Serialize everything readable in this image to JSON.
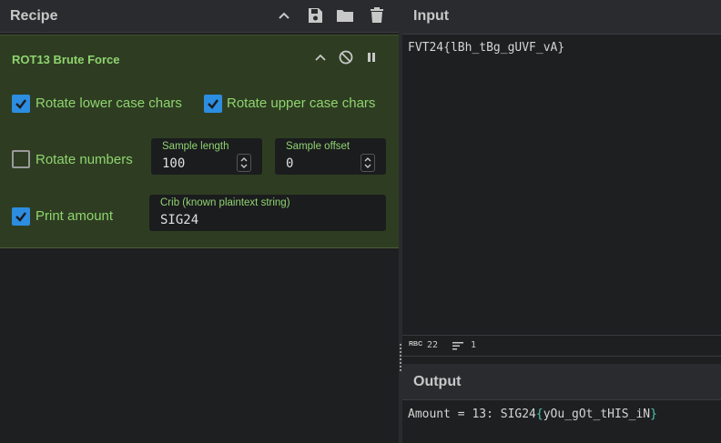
{
  "recipe": {
    "title": "Recipe",
    "header_icons": [
      "chevron-up-icon",
      "save-icon",
      "folder-icon",
      "trash-icon"
    ]
  },
  "operation": {
    "title": "ROT13 Brute Force",
    "icons": [
      "chevron-up-icon",
      "disable-icon",
      "pause-icon"
    ],
    "options": {
      "rotate_lower": {
        "label": "Rotate lower case chars",
        "checked": true
      },
      "rotate_upper": {
        "label": "Rotate upper case chars",
        "checked": true
      },
      "rotate_numbers": {
        "label": "Rotate numbers",
        "checked": false
      },
      "print_amount": {
        "label": "Print amount",
        "checked": true
      }
    },
    "fields": {
      "sample_length": {
        "label": "Sample length",
        "value": "100"
      },
      "sample_offset": {
        "label": "Sample offset",
        "value": "0"
      },
      "crib": {
        "label": "Crib (known plaintext string)",
        "value": "SIG24"
      }
    }
  },
  "input": {
    "title": "Input",
    "text": "FVT24{lBh_tBg_gUVF_vA}",
    "status": {
      "chars_label": "RBC",
      "chars": "22",
      "lines": "1"
    }
  },
  "output": {
    "title": "Output",
    "prefix": "Amount = 13: SIG24",
    "open_brace": "{",
    "inner": "yOu_gOt_tHIS_iN",
    "close_brace": "}"
  },
  "colors": {
    "accent_green": "#8fd46f",
    "card_bg": "#2e3d22",
    "checkbox_blue": "#2d8de0"
  }
}
